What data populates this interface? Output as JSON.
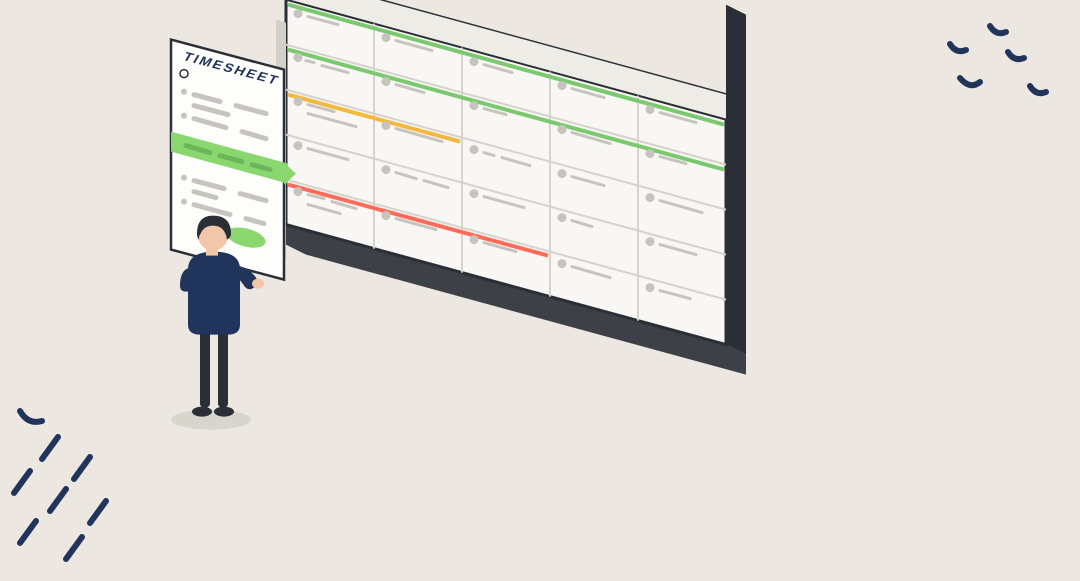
{
  "illustration": {
    "panel_title": "TIMESHEET"
  }
}
